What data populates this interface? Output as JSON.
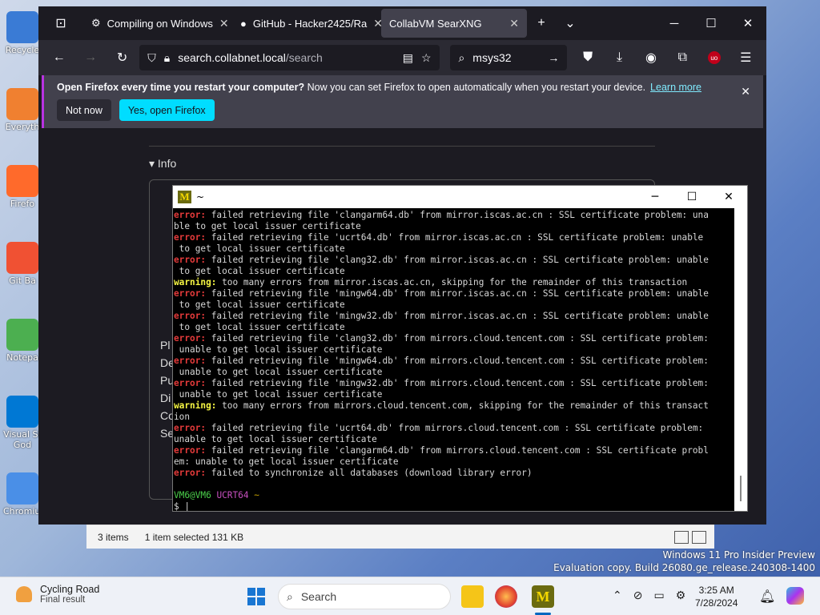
{
  "desktop": {
    "icons": [
      {
        "label": "Recycle",
        "color": "#3a7bd5"
      },
      {
        "label": "Everyth",
        "color": "#f08030"
      },
      {
        "label": "Firefo",
        "color": "#ff6a2b"
      },
      {
        "label": "Git Ba",
        "color": "#f05133"
      },
      {
        "label": "Notepa",
        "color": "#4caf50"
      },
      {
        "label": "Visual St\nGod",
        "color": "#0078d4"
      },
      {
        "label": "Chromium",
        "color": "#4a8fe7"
      }
    ],
    "watermark_line1": "Windows 11 Pro Insider Preview",
    "watermark_line2": "Evaluation copy. Build 26080.ge_release.240308-1400"
  },
  "explorer": {
    "items": "3 items",
    "selected": "1 item selected  131 KB"
  },
  "browser": {
    "tabs": [
      {
        "label": "Compiling on Windows",
        "active": false
      },
      {
        "label": "GitHub - Hacker2425/Ra",
        "active": false
      },
      {
        "label": "CollabVM SearXNG",
        "active": true
      }
    ],
    "url_domain": "search.collabnet.local",
    "url_path": "/search",
    "search_value": "msys32",
    "notification": {
      "bold": "Open Firefox every time you restart your computer?",
      "text": "Now you can set Firefox to open automatically when you restart your device.",
      "link": "Learn more",
      "btn_no": "Not now",
      "btn_yes": "Yes, open Firefox"
    },
    "info_label": "▾ Info",
    "left_letters": [
      "Pl",
      "De",
      "Pu",
      "Di",
      "Co",
      "Se"
    ]
  },
  "terminal": {
    "title": "~",
    "prompt_user": "VM6@VM6",
    "prompt_env": "UCRT64",
    "prompt_dir": "~",
    "prompt_symbol": "$",
    "lines": [
      {
        "t": "error:",
        "m": " failed retrieving file 'clangarm64.db' from mirror.iscas.ac.cn : SSL certificate problem: una"
      },
      {
        "t": "",
        "m": "ble to get local issuer certificate"
      },
      {
        "t": "error:",
        "m": " failed retrieving file 'ucrt64.db' from mirror.iscas.ac.cn : SSL certificate problem: unable"
      },
      {
        "t": "",
        "m": " to get local issuer certificate"
      },
      {
        "t": "error:",
        "m": " failed retrieving file 'clang32.db' from mirror.iscas.ac.cn : SSL certificate problem: unable"
      },
      {
        "t": "",
        "m": " to get local issuer certificate"
      },
      {
        "t": "warning:",
        "m": " too many errors from mirror.iscas.ac.cn, skipping for the remainder of this transaction"
      },
      {
        "t": "error:",
        "m": " failed retrieving file 'mingw64.db' from mirror.iscas.ac.cn : SSL certificate problem: unable"
      },
      {
        "t": "",
        "m": " to get local issuer certificate"
      },
      {
        "t": "error:",
        "m": " failed retrieving file 'mingw32.db' from mirror.iscas.ac.cn : SSL certificate problem: unable"
      },
      {
        "t": "",
        "m": " to get local issuer certificate"
      },
      {
        "t": "error:",
        "m": " failed retrieving file 'clang32.db' from mirrors.cloud.tencent.com : SSL certificate problem:"
      },
      {
        "t": "",
        "m": " unable to get local issuer certificate"
      },
      {
        "t": "error:",
        "m": " failed retrieving file 'mingw64.db' from mirrors.cloud.tencent.com : SSL certificate problem:"
      },
      {
        "t": "",
        "m": " unable to get local issuer certificate"
      },
      {
        "t": "error:",
        "m": " failed retrieving file 'mingw32.db' from mirrors.cloud.tencent.com : SSL certificate problem:"
      },
      {
        "t": "",
        "m": " unable to get local issuer certificate"
      },
      {
        "t": "warning:",
        "m": " too many errors from mirrors.cloud.tencent.com, skipping for the remainder of this transact"
      },
      {
        "t": "",
        "m": "ion"
      },
      {
        "t": "error:",
        "m": " failed retrieving file 'ucrt64.db' from mirrors.cloud.tencent.com : SSL certificate problem:"
      },
      {
        "t": "",
        "m": "unable to get local issuer certificate"
      },
      {
        "t": "error:",
        "m": " failed retrieving file 'clangarm64.db' from mirrors.cloud.tencent.com : SSL certificate probl"
      },
      {
        "t": "",
        "m": "em: unable to get local issuer certificate"
      },
      {
        "t": "error:",
        "m": " failed to synchronize all databases (download library error)"
      }
    ]
  },
  "taskbar": {
    "weather_title": "Cycling Road",
    "weather_sub": "Final result",
    "search_placeholder": "Search",
    "time": "3:25 AM",
    "date": "7/28/2024"
  }
}
